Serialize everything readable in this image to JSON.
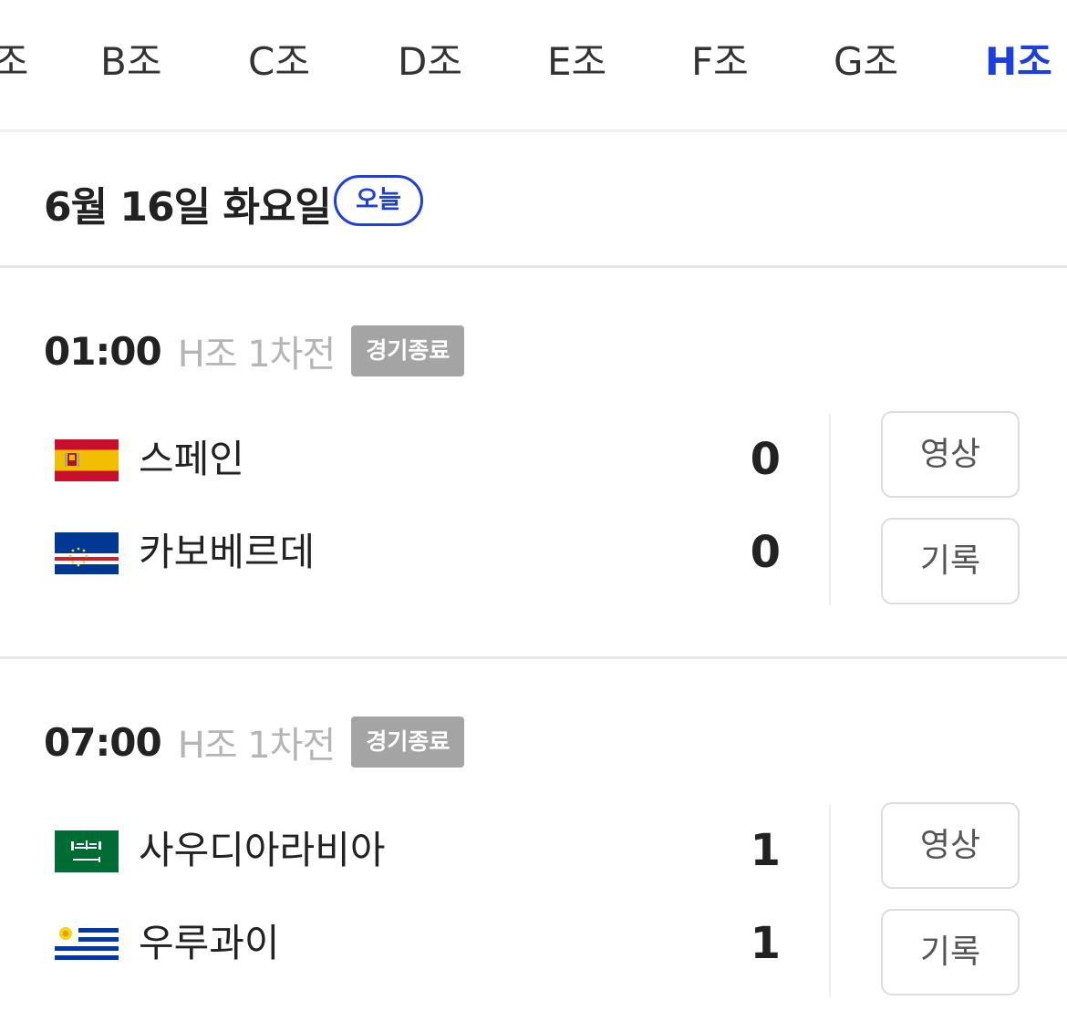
{
  "tabs": [
    {
      "label": "A조",
      "active": false
    },
    {
      "label": "B조",
      "active": false
    },
    {
      "label": "C조",
      "active": false
    },
    {
      "label": "D조",
      "active": false
    },
    {
      "label": "E조",
      "active": false
    },
    {
      "label": "F조",
      "active": false
    },
    {
      "label": "G조",
      "active": false
    },
    {
      "label": "H조",
      "active": true
    }
  ],
  "date_header": {
    "date": "6월 16일 화요일",
    "today_badge": "오늘"
  },
  "matches": [
    {
      "time": "01:00",
      "round": "H조 1차전",
      "status": "경기종료",
      "teams": [
        {
          "name": "스페인",
          "score": "0",
          "flag": "spain-flag-icon"
        },
        {
          "name": "카보베르데",
          "score": "0",
          "flag": "cape-verde-flag-icon"
        }
      ],
      "buttons": {
        "video": "영상",
        "record": "기록"
      }
    },
    {
      "time": "07:00",
      "round": "H조 1차전",
      "status": "경기종료",
      "teams": [
        {
          "name": "사우디아라비아",
          "score": "1",
          "flag": "saudi-arabia-flag-icon"
        },
        {
          "name": "우루과이",
          "score": "1",
          "flag": "uruguay-flag-icon"
        }
      ],
      "buttons": {
        "video": "영상",
        "record": "기록"
      }
    }
  ],
  "colors": {
    "accent": "#1c3fe0",
    "badge_bg": "#a4a4a4",
    "muted_text": "#b5b5b5"
  }
}
